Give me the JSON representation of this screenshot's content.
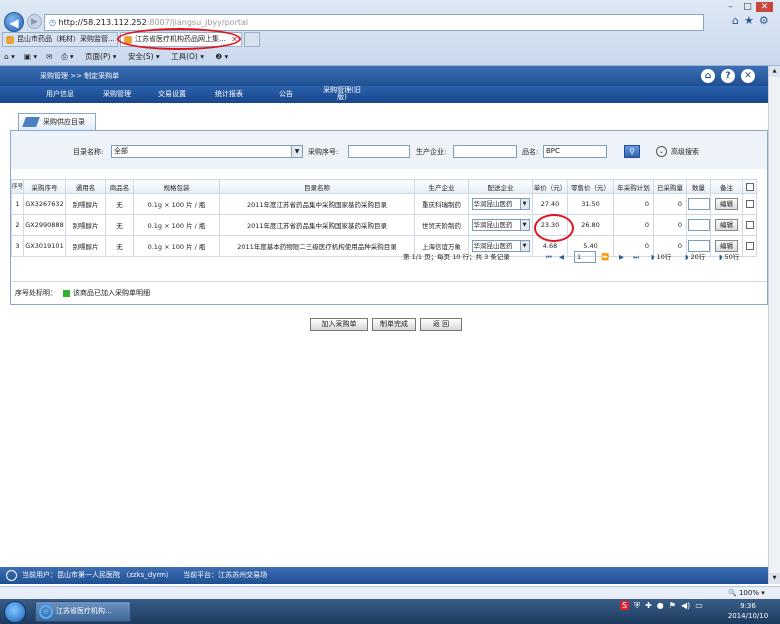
{
  "browser": {
    "url_host": "http://58.213.112.252",
    "url_rest": ":8007/jiangsu_jbyy/portal",
    "tabs": [
      {
        "label": "昆山市药品（耗材）采购监管..."
      },
      {
        "label": "江苏省医疗机构药品网上集..."
      }
    ],
    "cmd": {
      "page": "页面(P) ▾",
      "safety": "安全(S) ▾",
      "tools": "工具(O) ▾",
      "help": "❷ ▾"
    }
  },
  "header": {
    "breadcrumb": "采购管理 >> 制定采购单"
  },
  "menu": [
    "用户信息",
    "采购管理",
    "交易设置",
    "统计报表",
    "公告",
    "采购管理(旧版)"
  ],
  "subtab": "采购供应目录",
  "search": {
    "catalog_label": "目录名称:",
    "catalog_value": "全部",
    "code_label": "采购序号:",
    "code_value": "",
    "maker_label": "生产企业:",
    "maker_value": "",
    "name_label": "品名:",
    "name_value": "BPC",
    "advanced_label": "高级搜索"
  },
  "table": {
    "headers": [
      "序号",
      "采购序号",
      "通用名",
      "商品名",
      "规格包装",
      "目录名称",
      "生产企业",
      "配送企业",
      "单价（元）",
      "零售价（元）",
      "年采购计划",
      "已采购量",
      "数量",
      "备注"
    ],
    "rows": [
      {
        "no": "1",
        "code": "GX3267632",
        "generic": "别嘌醇片",
        "brand": "无",
        "spec": "0.1g × 100 片 / 瓶",
        "catalog": "2011年度江苏省药品集中采购国家基药采购目录",
        "maker": "重庆科瑞制药",
        "distributor": "华润昆山医药",
        "price": "27.40",
        "retail": "31.50",
        "plan": "0",
        "bought": "0",
        "edit": "编辑"
      },
      {
        "no": "2",
        "code": "GX2990888",
        "generic": "别嘌醇片",
        "brand": "无",
        "spec": "0.1g × 100 片 / 瓶",
        "catalog": "2011年度江苏省药品集中采购国家基药采购目录",
        "maker": "世贸天阶制药",
        "distributor": "华润昆山医药",
        "price": "23.30",
        "retail": "26.80",
        "plan": "0",
        "bought": "0",
        "edit": "编辑"
      },
      {
        "no": "3",
        "code": "GX3019101",
        "generic": "别嘌醇片",
        "brand": "无",
        "spec": "0.1g × 100 片 / 瓶",
        "catalog": "2011年度基本药物限二三级医疗机构使用品种采购目录",
        "maker": "上海信谊万象",
        "distributor": "华润昆山医药",
        "price": "4.68",
        "retail": "5.40",
        "plan": "0",
        "bought": "0",
        "edit": "编辑"
      }
    ]
  },
  "pager": {
    "info": "第 1/1 页；每页 10 行；共 3 条记录",
    "page_input": "1",
    "size_10": "10行",
    "size_20": "20行",
    "size_50": "50行"
  },
  "legend": {
    "label": "序号处标明：",
    "text": "该商品已加入采购单明细"
  },
  "actions": {
    "add": "加入采购单",
    "finish": "制单完成",
    "back": "返 回"
  },
  "footer": {
    "user": "当前用户：昆山市第一人民医院 （zzks_dyrm）",
    "platform": "当前平台：江苏苏州交易场"
  },
  "status": {
    "zoom": "100%"
  },
  "taskbar": {
    "item": "江苏省医疗机构...",
    "time": "9:36",
    "date": "2014/10/10"
  }
}
